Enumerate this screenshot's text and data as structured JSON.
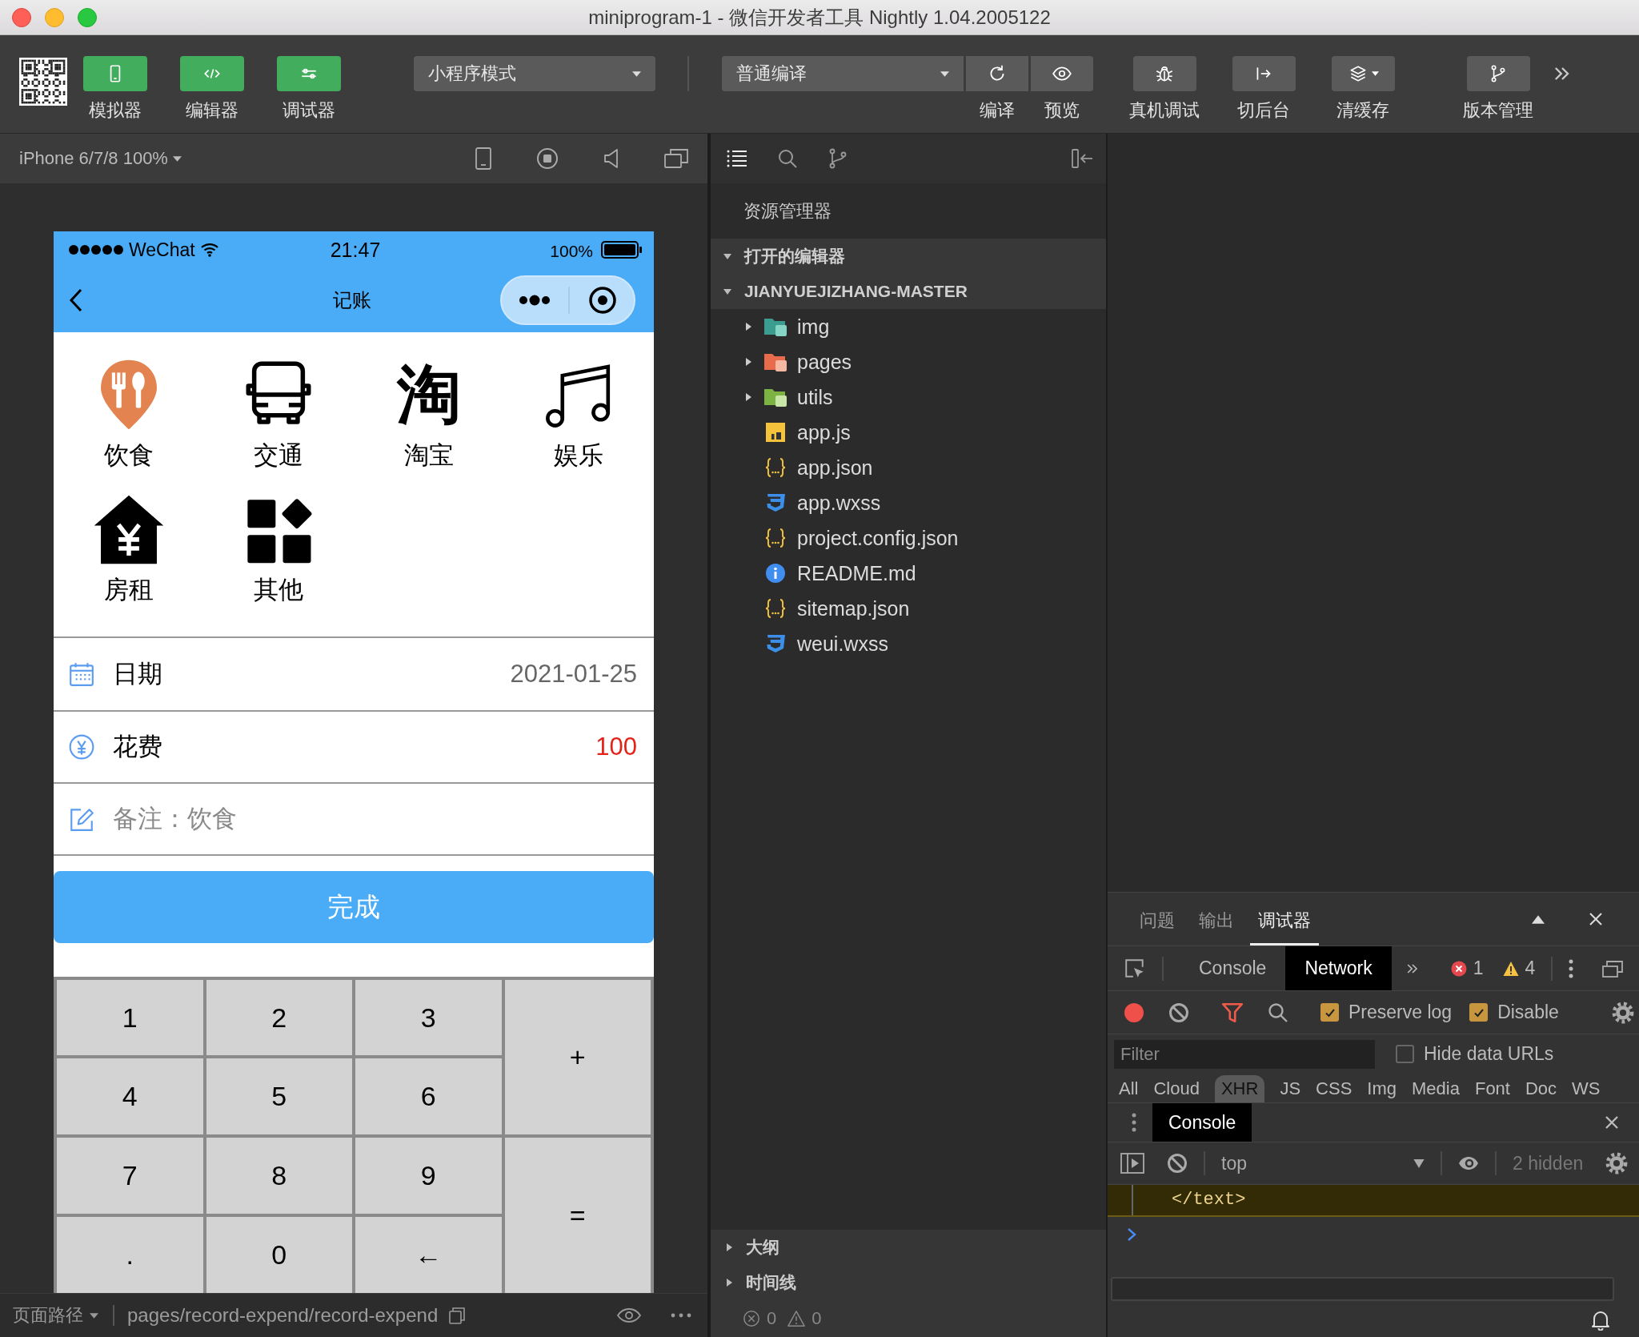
{
  "window": {
    "title": "miniprogram-1 - 微信开发者工具 Nightly 1.04.2005122"
  },
  "toolbar": {
    "view_toggles": [
      {
        "label": "模拟器",
        "on": true
      },
      {
        "label": "编辑器",
        "on": true
      },
      {
        "label": "调试器",
        "on": true
      }
    ],
    "mode_select": {
      "value": "小程序模式"
    },
    "compile_select": {
      "value": "普通编译"
    },
    "compile_actions": [
      {
        "label": "编译"
      },
      {
        "label": "预览"
      }
    ],
    "tools": [
      {
        "label": "真机调试"
      },
      {
        "label": "切后台"
      },
      {
        "label": "清缓存"
      },
      {
        "label": "版本管理"
      }
    ]
  },
  "simulator": {
    "device_select": "iPhone 6/7/8 100%",
    "phone": {
      "status_bar": {
        "carrier": "WeChat",
        "time": "21:47",
        "battery": "100%"
      },
      "nav_bar": {
        "title": "记账"
      },
      "categories": [
        {
          "label": "饮食",
          "selected": true
        },
        {
          "label": "交通",
          "selected": false
        },
        {
          "glyph": "淘",
          "label": "淘宝",
          "selected": false
        },
        {
          "label": "娱乐",
          "selected": false
        },
        {
          "label": "房租",
          "selected": false
        },
        {
          "label": "其他",
          "selected": false
        }
      ],
      "fields": [
        {
          "kind": "date",
          "label": "日期",
          "value": "2021-01-25"
        },
        {
          "kind": "amount",
          "label": "花费",
          "value": "100"
        },
        {
          "kind": "note",
          "placeholder": "备注：饮食"
        }
      ],
      "submit_button": "完成",
      "keypad": [
        {
          "label": "1",
          "kind": "key"
        },
        {
          "label": "2",
          "kind": "key"
        },
        {
          "label": "3",
          "kind": "key"
        },
        {
          "label": "+",
          "kind": "tall"
        },
        {
          "label": "4",
          "kind": "key"
        },
        {
          "label": "5",
          "kind": "key"
        },
        {
          "label": "6",
          "kind": "key"
        },
        {
          "label": "7",
          "kind": "key"
        },
        {
          "label": "8",
          "kind": "key"
        },
        {
          "label": "9",
          "kind": "key"
        },
        {
          "label": "=",
          "kind": "tall"
        },
        {
          "label": ".",
          "kind": "key"
        },
        {
          "label": "0",
          "kind": "key"
        },
        {
          "label": "←",
          "kind": "key"
        }
      ]
    },
    "page_path": {
      "label": "页面路径",
      "value": "pages/record-expend/record-expend"
    }
  },
  "explorer": {
    "title": "资源管理器",
    "sections": [
      {
        "label": "打开的编辑器",
        "expanded": true
      },
      {
        "label": "JIANYUEJIZHANG-MASTER",
        "expanded": true,
        "children": [
          {
            "name": "img",
            "kind": "folder",
            "expanded": false
          },
          {
            "name": "pages",
            "kind": "folder",
            "expanded": false
          },
          {
            "name": "utils",
            "kind": "folder",
            "expanded": false
          },
          {
            "name": "app.js",
            "kind": "js"
          },
          {
            "name": "app.json",
            "kind": "json"
          },
          {
            "name": "app.wxss",
            "kind": "wxss"
          },
          {
            "name": "project.config.json",
            "kind": "json"
          },
          {
            "name": "README.md",
            "kind": "md"
          },
          {
            "name": "sitemap.json",
            "kind": "json"
          },
          {
            "name": "weui.wxss",
            "kind": "wxss"
          }
        ]
      }
    ],
    "panels": [
      {
        "label": "大纲",
        "expanded": false
      },
      {
        "label": "时间线",
        "expanded": false
      }
    ],
    "problems": {
      "errors": "0",
      "warnings": "0"
    }
  },
  "devtools": {
    "tabs": [
      {
        "label": "问题",
        "selected": false
      },
      {
        "label": "输出",
        "selected": false
      },
      {
        "label": "调试器",
        "selected": true
      }
    ],
    "panel_tabs": [
      {
        "label": "Console",
        "selected": false
      },
      {
        "label": "Network",
        "selected": true
      }
    ],
    "error_count": "1",
    "warning_count": "4",
    "network": {
      "recording": true,
      "options": [
        {
          "label": "Preserve log",
          "checked": true
        },
        {
          "label": "Disable",
          "checked": true
        }
      ],
      "filter": {
        "placeholder": "Filter"
      },
      "hide_data_urls": {
        "label": "Hide data URLs",
        "checked": false
      },
      "types": [
        {
          "label": "All",
          "selected": false
        },
        {
          "label": "Cloud",
          "selected": false
        },
        {
          "label": "XHR",
          "selected": true
        },
        {
          "label": "JS",
          "selected": false
        },
        {
          "label": "CSS",
          "selected": false
        },
        {
          "label": "Img",
          "selected": false
        },
        {
          "label": "Media",
          "selected": false
        },
        {
          "label": "Font",
          "selected": false
        },
        {
          "label": "Doc",
          "selected": false
        },
        {
          "label": "WS",
          "selected": false
        }
      ]
    },
    "drawer": {
      "tabs": [
        {
          "label": "Console",
          "selected": true
        }
      ],
      "context": "top",
      "hidden_count": "2 hidden",
      "messages": [
        {
          "kind": "warning",
          "text": "</text>"
        }
      ]
    }
  }
}
